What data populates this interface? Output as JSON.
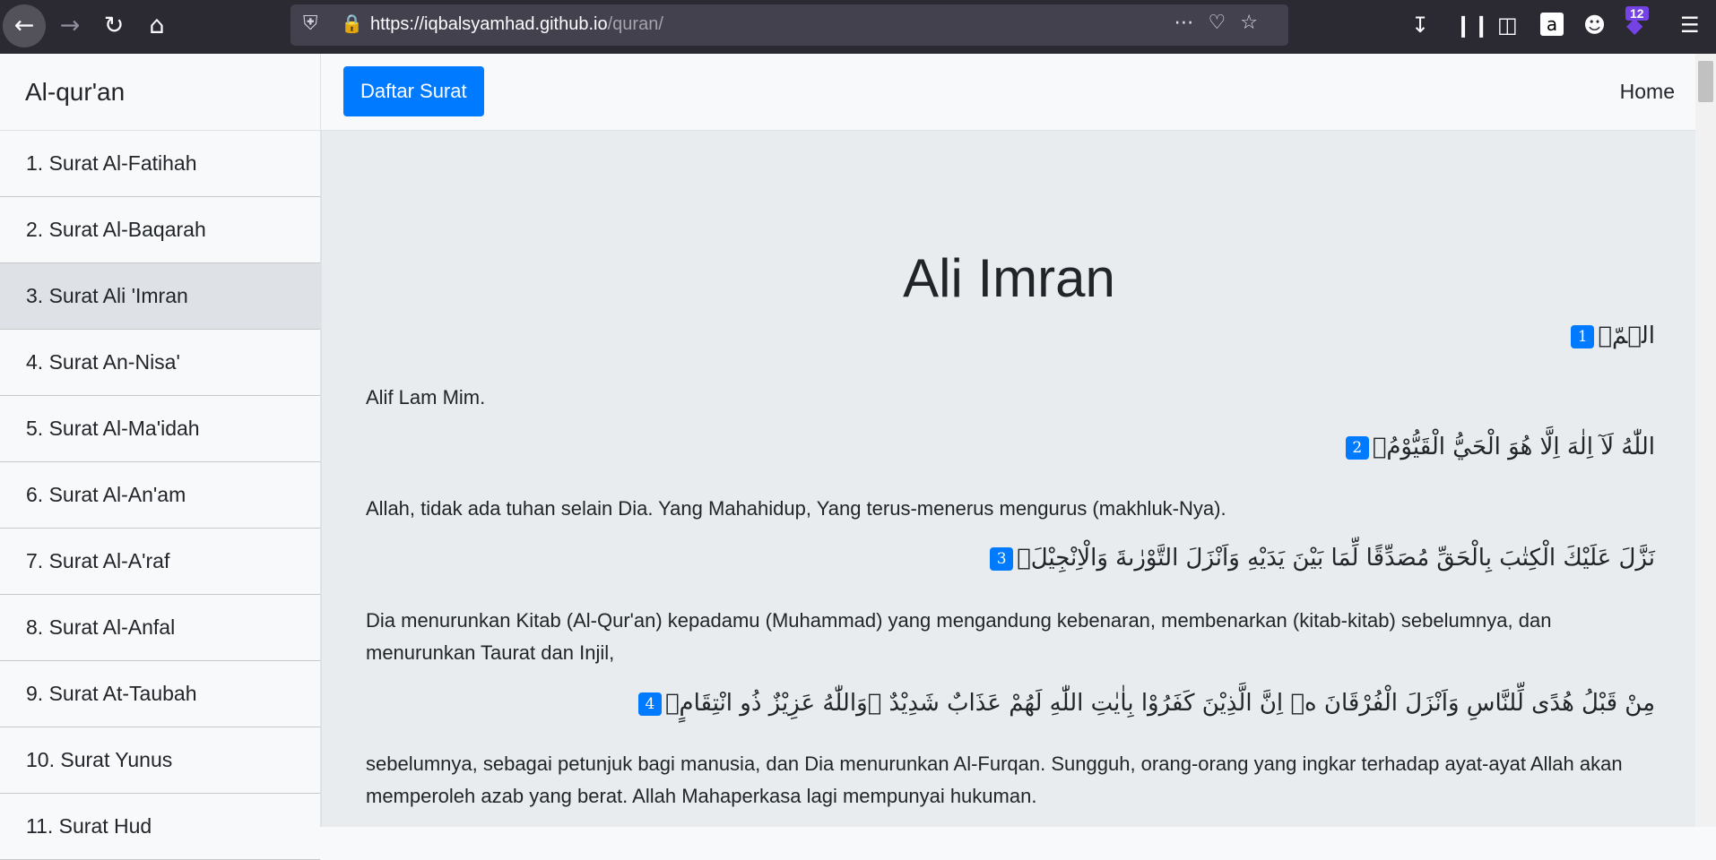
{
  "browser": {
    "url_host": "https://iqbalsyamhad.github.io",
    "url_path": "/quran/",
    "notification_count": "12"
  },
  "sidebar": {
    "brand": "Al-qur'an",
    "items": [
      {
        "label": "1. Surat Al-Fatihah",
        "active": false
      },
      {
        "label": "2. Surat Al-Baqarah",
        "active": false
      },
      {
        "label": "3. Surat Ali 'Imran",
        "active": true
      },
      {
        "label": "4. Surat An-Nisa'",
        "active": false
      },
      {
        "label": "5. Surat Al-Ma'idah",
        "active": false
      },
      {
        "label": "6. Surat Al-An'am",
        "active": false
      },
      {
        "label": "7. Surat Al-A'raf",
        "active": false
      },
      {
        "label": "8. Surat Al-Anfal",
        "active": false
      },
      {
        "label": "9. Surat At-Taubah",
        "active": false
      },
      {
        "label": "10. Surat Yunus",
        "active": false
      },
      {
        "label": "11. Surat Hud",
        "active": false
      }
    ]
  },
  "topnav": {
    "daftar_label": "Daftar Surat",
    "home_label": "Home"
  },
  "content": {
    "title": "Ali Imran",
    "ayahs": [
      {
        "number": "1",
        "arabic": "الۤمّۤ",
        "translation": "Alif Lam Mim."
      },
      {
        "number": "2",
        "arabic": "اللّٰهُ لَآ اِلٰهَ اِلَّا هُوَ الْحَيُّ الْقَيُّوْمُۗ",
        "translation": "Allah, tidak ada tuhan selain Dia. Yang Mahahidup, Yang terus-menerus mengurus (makhluk-Nya)."
      },
      {
        "number": "3",
        "arabic": "نَزَّلَ عَلَيْكَ الْكِتٰبَ بِالْحَقِّ مُصَدِّقًا لِّمَا بَيْنَ يَدَيْهِ وَاَنْزَلَ التَّوْرٰىةَ وَالْاِنْجِيْلَۙ",
        "translation": "Dia menurunkan Kitab (Al-Qur'an) kepadamu (Muhammad) yang mengandung kebenaran, membenarkan (kitab-kitab) sebelumnya, dan menurunkan Taurat dan Injil,"
      },
      {
        "number": "4",
        "arabic": "مِنْ قَبْلُ هُدًى لِّلنَّاسِ وَاَنْزَلَ الْفُرْقَانَ ەۗ اِنَّ الَّذِيْنَ كَفَرُوْا بِاٰيٰتِ اللّٰهِ لَهُمْ عَذَابٌ شَدِيْدٌ ۗوَاللّٰهُ عَزِيْزٌ ذُو انْتِقَامٍۗ",
        "translation": "sebelumnya, sebagai petunjuk bagi manusia, dan Dia menurunkan Al-Furqan. Sungguh, orang-orang yang ingkar terhadap ayat-ayat Allah akan memperoleh azab yang berat. Allah Mahaperkasa lagi mempunyai hukuman."
      }
    ]
  }
}
